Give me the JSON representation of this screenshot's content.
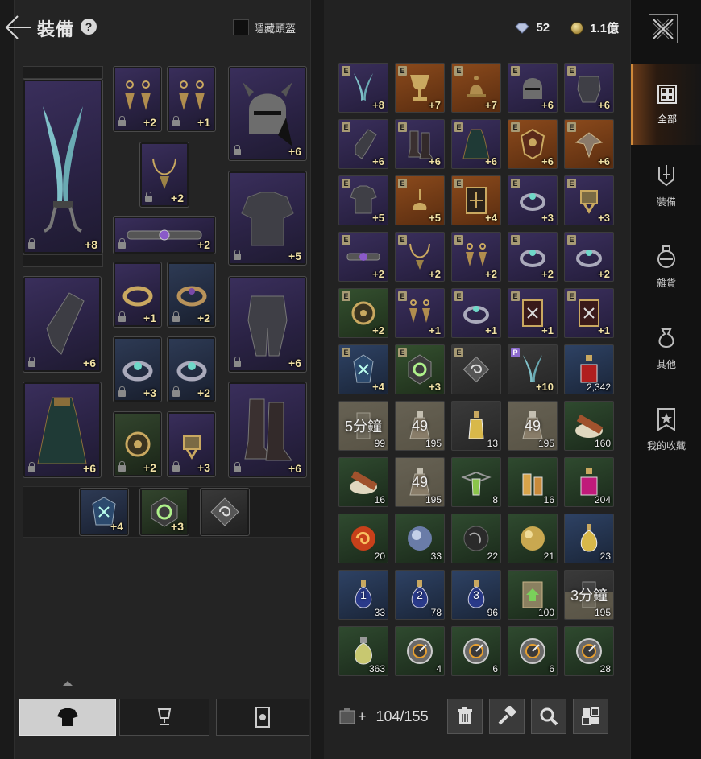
{
  "header": {
    "title": "裝備",
    "help": "?",
    "hide_helmet_label": "隱藏頭盔"
  },
  "currency": {
    "diamonds": "52",
    "gold": "1.1億"
  },
  "equipment": {
    "weapon_level": "+8",
    "earring_left_level": "+2",
    "earring_right_level": "+1",
    "necklace_level": "+2",
    "belt_level": "+2",
    "ring_1_level": "+1",
    "ring_2_level": "+2",
    "ring_3_level": "+3",
    "ring_4_level": "+2",
    "rune_1_level": "+2",
    "rune_2_level": "+3",
    "helmet_level": "+6",
    "armor_level": "+5",
    "gloves_level": "+6",
    "legs_level": "+6",
    "cloak_level": "+6",
    "boots_level": "+6",
    "relic_1_level": "+4",
    "relic_2_level": "+3"
  },
  "inventory": {
    "cells": [
      {
        "badge": "E",
        "value": "+8",
        "kind": "plus",
        "color": "purple",
        "icon": "daggers-icon"
      },
      {
        "badge": "E",
        "value": "+7",
        "kind": "plus",
        "color": "orange",
        "icon": "chalice-icon"
      },
      {
        "badge": "E",
        "value": "+7",
        "kind": "plus",
        "color": "orange",
        "icon": "bell-icon"
      },
      {
        "badge": "E",
        "value": "+6",
        "kind": "plus",
        "color": "purple",
        "icon": "helmet-icon"
      },
      {
        "badge": "E",
        "value": "+6",
        "kind": "plus",
        "color": "purple",
        "icon": "pauldron-icon"
      },
      {
        "badge": "E",
        "value": "+6",
        "kind": "plus",
        "color": "purple",
        "icon": "gauntlet-icon"
      },
      {
        "badge": "E",
        "value": "+6",
        "kind": "plus",
        "color": "purple",
        "icon": "boots-icon"
      },
      {
        "badge": "E",
        "value": "+6",
        "kind": "plus",
        "color": "purple",
        "icon": "cloak-icon"
      },
      {
        "badge": "E",
        "value": "+6",
        "kind": "plus",
        "color": "orange",
        "icon": "crest-icon"
      },
      {
        "badge": "E",
        "value": "+6",
        "kind": "plus",
        "color": "orange",
        "icon": "angel-icon"
      },
      {
        "badge": "E",
        "value": "+5",
        "kind": "plus",
        "color": "purple",
        "icon": "chest-armor-icon"
      },
      {
        "badge": "E",
        "value": "+5",
        "kind": "plus",
        "color": "orange",
        "icon": "lamp-icon"
      },
      {
        "badge": "E",
        "value": "+4",
        "kind": "plus",
        "color": "orange",
        "icon": "tome-icon"
      },
      {
        "badge": "E",
        "value": "+3",
        "kind": "plus",
        "color": "purple",
        "icon": "ring-icon"
      },
      {
        "badge": "E",
        "value": "+3",
        "kind": "plus",
        "color": "purple",
        "icon": "signet-icon"
      },
      {
        "badge": "E",
        "value": "+2",
        "kind": "plus",
        "color": "purple",
        "icon": "belt-icon"
      },
      {
        "badge": "E",
        "value": "+2",
        "kind": "plus",
        "color": "purple",
        "icon": "necklace-icon"
      },
      {
        "badge": "E",
        "value": "+2",
        "kind": "plus",
        "color": "purple",
        "icon": "earrings-icon"
      },
      {
        "badge": "E",
        "value": "+2",
        "kind": "plus",
        "color": "purple",
        "icon": "ring-icon"
      },
      {
        "badge": "E",
        "value": "+2",
        "kind": "plus",
        "color": "purple",
        "icon": "ring-icon"
      },
      {
        "badge": "E",
        "value": "+2",
        "kind": "plus",
        "color": "green",
        "icon": "rune-icon"
      },
      {
        "badge": "E",
        "value": "+1",
        "kind": "plus",
        "color": "purple",
        "icon": "earrings-icon"
      },
      {
        "badge": "E",
        "value": "+1",
        "kind": "plus",
        "color": "purple",
        "icon": "ring-icon"
      },
      {
        "badge": "E",
        "value": "+1",
        "kind": "plus",
        "color": "purple",
        "icon": "card-icon"
      },
      {
        "badge": "E",
        "value": "+1",
        "kind": "plus",
        "color": "purple",
        "icon": "card-icon"
      },
      {
        "badge": "E",
        "value": "+4",
        "kind": "plus",
        "color": "blue",
        "icon": "crystal-icon"
      },
      {
        "badge": "E",
        "value": "+3",
        "kind": "plus",
        "color": "green",
        "icon": "sigil-icon"
      },
      {
        "badge": "E",
        "value": "",
        "kind": "plus",
        "color": "grey",
        "icon": "swirl-stone-icon"
      },
      {
        "badge": "P",
        "value": "+10",
        "kind": "plus",
        "color": "grey",
        "icon": "daggers-icon"
      },
      {
        "badge": "",
        "value": "2,342",
        "kind": "count",
        "color": "blue",
        "icon": "red-potion-icon"
      },
      {
        "badge": "",
        "value": "99",
        "kind": "count",
        "color": "grey",
        "icon": "timer-icon",
        "timer": "5分鐘",
        "cool": 1.0
      },
      {
        "badge": "",
        "value": "195",
        "kind": "count",
        "color": "grey",
        "icon": "flask-icon",
        "timer": "49",
        "cool": 1.0
      },
      {
        "badge": "",
        "value": "13",
        "kind": "count",
        "color": "grey",
        "icon": "yellow-vial-icon"
      },
      {
        "badge": "",
        "value": "195",
        "kind": "count",
        "color": "grey",
        "icon": "flask-icon",
        "timer": "49",
        "cool": 1.0
      },
      {
        "badge": "",
        "value": "160",
        "kind": "count",
        "color": "dgreen",
        "icon": "skewer-plate-icon"
      },
      {
        "badge": "",
        "value": "16",
        "kind": "count",
        "color": "dgreen",
        "icon": "skewer-plate-icon"
      },
      {
        "badge": "",
        "value": "195",
        "kind": "count",
        "color": "grey",
        "icon": "flask-icon",
        "timer": "49",
        "cool": 1.0
      },
      {
        "badge": "",
        "value": "8",
        "kind": "count",
        "color": "dgreen",
        "icon": "winged-vial-icon"
      },
      {
        "badge": "",
        "value": "16",
        "kind": "count",
        "color": "dgreen",
        "icon": "twin-vials-icon"
      },
      {
        "badge": "",
        "value": "204",
        "kind": "count",
        "color": "dgreen",
        "icon": "pink-potion-icon"
      },
      {
        "badge": "",
        "value": "20",
        "kind": "count",
        "color": "dgreen",
        "icon": "fire-orb-icon"
      },
      {
        "badge": "",
        "value": "33",
        "kind": "count",
        "color": "dgreen",
        "icon": "moon-orb-icon"
      },
      {
        "badge": "",
        "value": "22",
        "kind": "count",
        "color": "dgreen",
        "icon": "dark-orb-icon"
      },
      {
        "badge": "",
        "value": "21",
        "kind": "count",
        "color": "dgreen",
        "icon": "gold-orb-icon"
      },
      {
        "badge": "",
        "value": "23",
        "kind": "count",
        "color": "blue",
        "icon": "gold-potion-icon"
      },
      {
        "badge": "",
        "value": "33",
        "kind": "count",
        "color": "blue",
        "icon": "blue-potion-1-icon",
        "numeral": "1"
      },
      {
        "badge": "",
        "value": "78",
        "kind": "count",
        "color": "blue",
        "icon": "blue-potion-2-icon",
        "numeral": "2"
      },
      {
        "badge": "",
        "value": "96",
        "kind": "count",
        "color": "blue",
        "icon": "blue-potion-3-icon",
        "numeral": "3"
      },
      {
        "badge": "",
        "value": "100",
        "kind": "count",
        "color": "dgreen",
        "icon": "scroll-icon"
      },
      {
        "badge": "",
        "value": "195",
        "kind": "count",
        "color": "grey",
        "icon": "timer-icon",
        "timer": "3分鐘",
        "cool": 0.55
      },
      {
        "badge": "",
        "value": "363",
        "kind": "count",
        "color": "dgreen",
        "icon": "elixir-icon"
      },
      {
        "badge": "",
        "value": "4",
        "kind": "count",
        "color": "dgreen",
        "icon": "disc-icon"
      },
      {
        "badge": "",
        "value": "6",
        "kind": "count",
        "color": "dgreen",
        "icon": "disc-icon"
      },
      {
        "badge": "",
        "value": "6",
        "kind": "count",
        "color": "dgreen",
        "icon": "disc-icon"
      },
      {
        "badge": "",
        "value": "28",
        "kind": "count",
        "color": "dgreen",
        "icon": "disc-icon"
      }
    ],
    "bag_count": "104/155",
    "bag_plus": "+"
  },
  "side_nav": {
    "items": [
      {
        "label": "全部",
        "icon": "grid-icon",
        "active": true
      },
      {
        "label": "裝備",
        "icon": "sword-icon",
        "active": false
      },
      {
        "label": "雜貨",
        "icon": "pot-icon",
        "active": false
      },
      {
        "label": "其他",
        "icon": "pouch-icon",
        "active": false
      },
      {
        "label": "我的收藏",
        "icon": "bookmark-star-icon",
        "active": false
      }
    ]
  },
  "colors": {
    "accent": "#d08a3a",
    "level_text": "#f2e2a6"
  }
}
